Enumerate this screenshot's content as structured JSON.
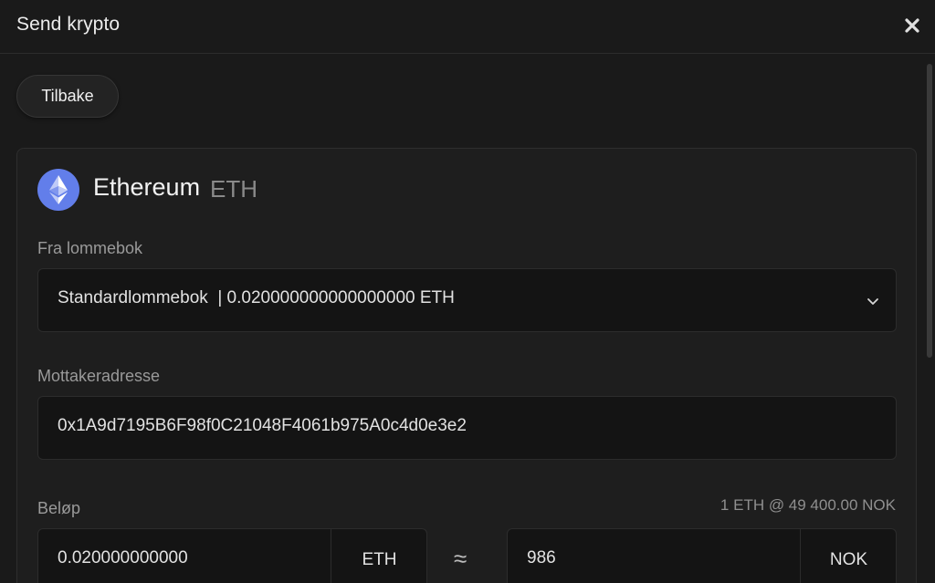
{
  "header": {
    "title": "Send krypto",
    "close_icon": "close-icon"
  },
  "back_button": {
    "label": "Tilbake"
  },
  "coin": {
    "name": "Ethereum",
    "ticker": "ETH",
    "logo_icon": "ethereum-icon",
    "logo_color": "#627EEA"
  },
  "from_wallet": {
    "label": "Fra lommebok",
    "selected": "Standardlommebok  | 0.020000000000000000 ETH"
  },
  "recipient": {
    "label": "Mottakeradresse",
    "value": "0x1A9d7195B6F98f0C21048F4061b975A0c4d0e3e2"
  },
  "amount": {
    "label": "Beløp",
    "rate": "1 ETH @ 49 400.00 NOK",
    "crypto_value": "0.020000000000",
    "crypto_unit": "ETH",
    "approx_symbol": "≈",
    "fiat_value": "986",
    "fiat_unit": "NOK"
  }
}
